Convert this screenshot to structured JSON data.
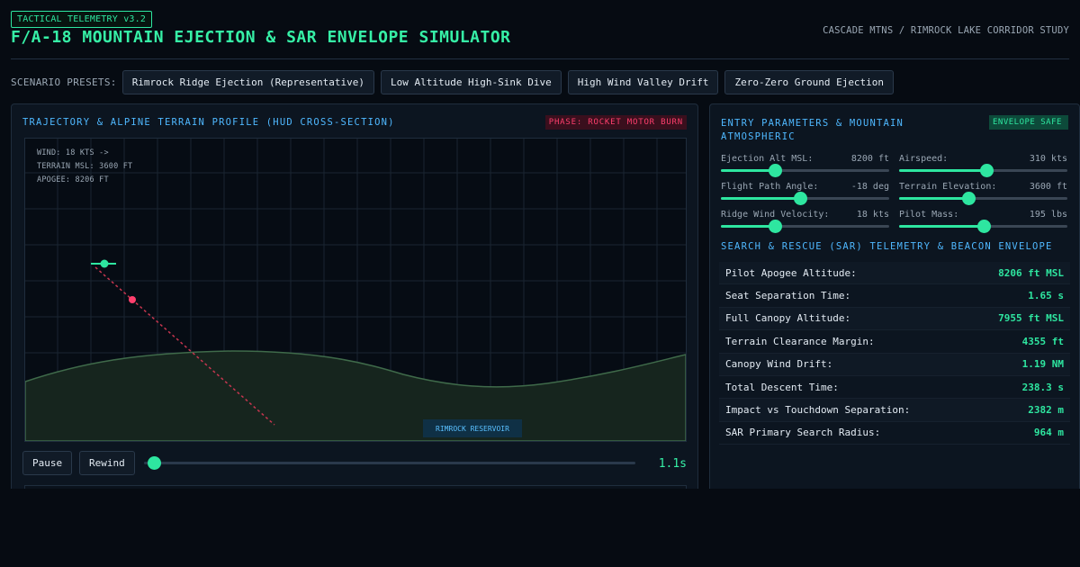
{
  "header": {
    "version_tag": "TACTICAL TELEMETRY v3.2",
    "title": "F/A-18 MOUNTAIN EJECTION & SAR ENVELOPE SIMULATOR",
    "subtitle": "CASCADE MTNS / RIMROCK LAKE CORRIDOR STUDY"
  },
  "presets": {
    "label": "SCENARIO PRESETS:",
    "items": [
      {
        "label": "Rimrock Ridge Ejection (Representative)"
      },
      {
        "label": "Low Altitude High-Sink Dive"
      },
      {
        "label": "High Wind Valley Drift"
      },
      {
        "label": "Zero-Zero Ground Ejection"
      }
    ]
  },
  "trajectory": {
    "title": "TRAJECTORY & ALPINE TERRAIN PROFILE (HUD CROSS-SECTION)",
    "phase": "PHASE: ROCKET MOTOR BURN",
    "hud_lines": [
      "WIND: 18 KTS ->",
      "TERRAIN MSL: 3600 FT",
      "APOGEE: 8206 FT"
    ],
    "reservoir_label": "RIMROCK RESERVOIR",
    "colors": {
      "terrain_fill": "#16251e",
      "terrain_line": "#3f6a4a",
      "trajectory": "#c7364f",
      "pilot": "#ff3f6d",
      "aircraft": "#2ee6a0"
    },
    "controls": {
      "pause_label": "Pause",
      "rewind_label": "Rewind",
      "time_readout": "1.1s",
      "timeline_progress": 0.02
    }
  },
  "params": {
    "title": "ENTRY PARAMETERS & MOUNTAIN ATMOSPHERIC",
    "status_badge": "ENVELOPE SAFE",
    "sliders": [
      {
        "name": "Ejection Alt MSL:",
        "value": "8200 ft",
        "fraction": 0.32
      },
      {
        "name": "Airspeed:",
        "value": "310 kts",
        "fraction": 0.52
      },
      {
        "name": "Flight Path Angle:",
        "value": "-18 deg",
        "fraction": 0.47
      },
      {
        "name": "Terrain Elevation:",
        "value": "3600 ft",
        "fraction": 0.41
      },
      {
        "name": "Ridge Wind Velocity:",
        "value": "18 kts",
        "fraction": 0.32
      },
      {
        "name": "Pilot Mass:",
        "value": "195 lbs",
        "fraction": 0.5
      }
    ]
  },
  "sar": {
    "title": "SEARCH & RESCUE (SAR) TELEMETRY & BEACON ENVELOPE",
    "rows": [
      {
        "label": "Pilot Apogee Altitude:",
        "value": "8206 ft MSL"
      },
      {
        "label": "Seat Separation Time:",
        "value": "1.65 s"
      },
      {
        "label": "Full Canopy Altitude:",
        "value": "7955 ft MSL"
      },
      {
        "label": "Terrain Clearance Margin:",
        "value": "4355 ft"
      },
      {
        "label": "Canopy Wind Drift:",
        "value": "1.19 NM"
      },
      {
        "label": "Total Descent Time:",
        "value": "238.3 s"
      },
      {
        "label": "Impact vs Touchdown Separation:",
        "value": "2382 m"
      },
      {
        "label": "SAR Primary Search Radius:",
        "value": "964 m"
      }
    ]
  }
}
